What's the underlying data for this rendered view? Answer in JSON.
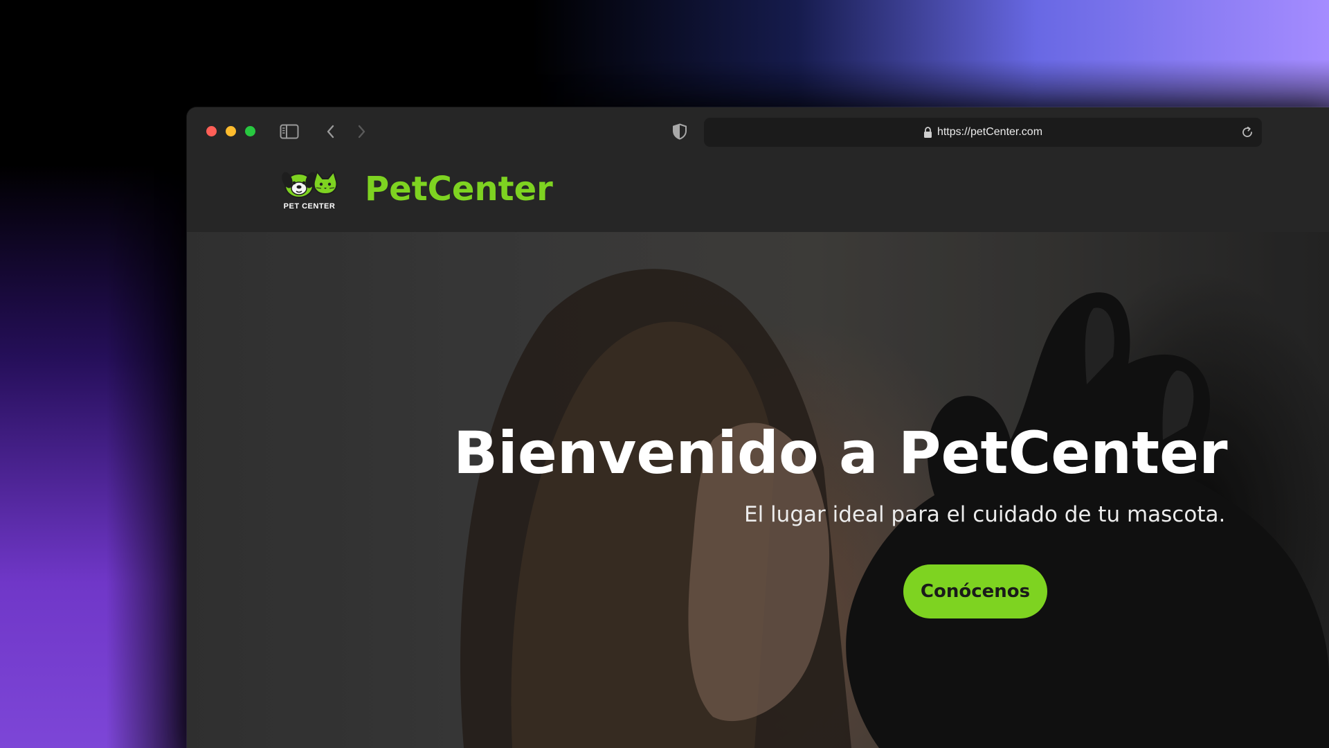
{
  "browser": {
    "url": "https://petCenter.com",
    "icons": {
      "close": "traffic-light-red",
      "minimize": "traffic-light-yellow",
      "zoom": "traffic-light-green",
      "sidebar": "sidebar-icon",
      "back": "chevron-left-icon",
      "forward": "chevron-right-icon",
      "privacy": "shield-icon",
      "lock": "lock-icon",
      "reload": "reload-icon"
    }
  },
  "site": {
    "logo_caption": "PET CENTER",
    "brand_name": "PetCenter",
    "brand_color": "#7ed321"
  },
  "hero": {
    "title": "Bienvenido a PetCenter",
    "subtitle": "El lugar ideal para el cuidado de tu mascota.",
    "cta_label": "Conócenos",
    "cta_color": "#7ed321"
  }
}
